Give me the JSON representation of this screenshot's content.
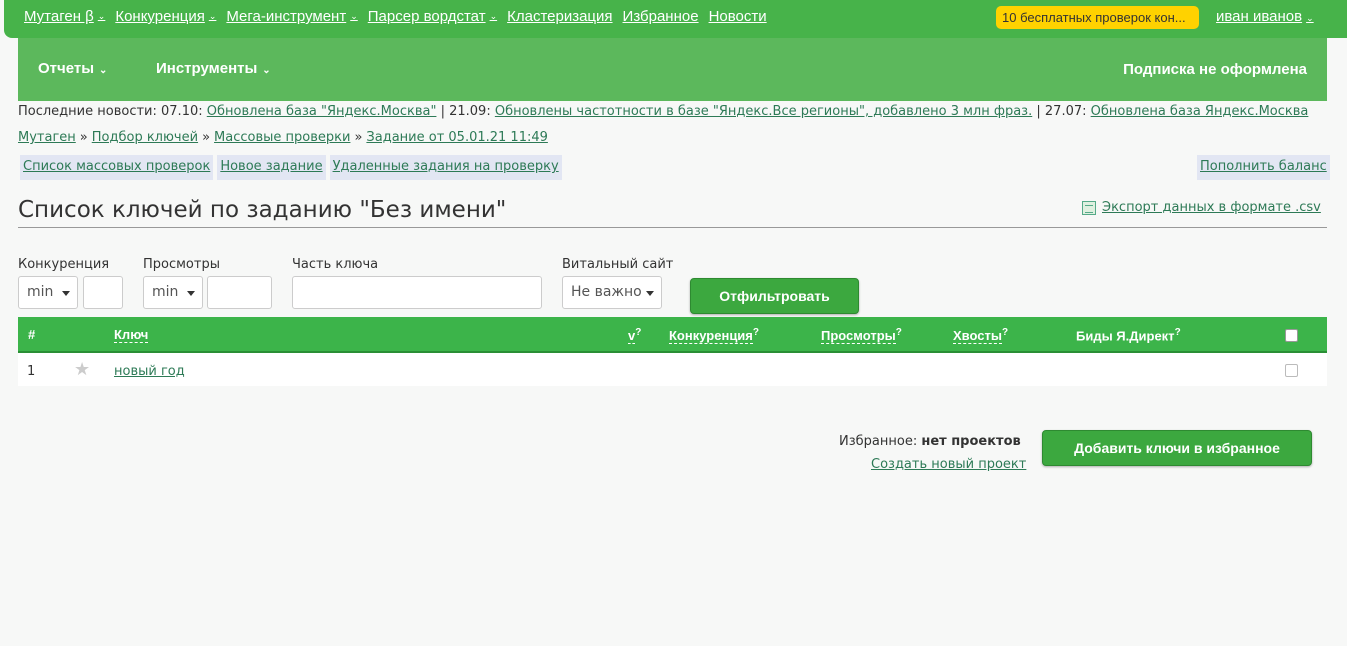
{
  "topnav": {
    "items": [
      {
        "label": "Мутаген β",
        "dropdown": true
      },
      {
        "label": "Конкуренция",
        "dropdown": true
      },
      {
        "label": "Мега-инструмент",
        "dropdown": true
      },
      {
        "label": "Парсер вордстат",
        "dropdown": true
      },
      {
        "label": "Кластеризация",
        "dropdown": false
      },
      {
        "label": "Избранное",
        "dropdown": false
      },
      {
        "label": "Новости",
        "dropdown": false
      }
    ],
    "promo": "10 бесплатных проверок кон...",
    "user": "иван иванов"
  },
  "subbar": {
    "reports": "Отчеты",
    "tools": "Инструменты",
    "subscription": "Подписка не оформлена"
  },
  "news": {
    "prefix": "Последние новости:",
    "items": [
      {
        "date": "07.10:",
        "text": "Обновлена база \"Яндекс.Москва\""
      },
      {
        "date": "21.09:",
        "text": "Обновлены частотности в базе \"Яндекс.Все регионы\", добавлено 3 млн фраз."
      },
      {
        "date": "27.07:",
        "text": "Обновлена база Яндекс.Москва"
      }
    ]
  },
  "breadcrumbs": [
    "Мутаген",
    "Подбор ключей",
    "Массовые проверки",
    "Задание от 05.01.21 11:49"
  ],
  "tabs": {
    "list": "Список массовых проверок",
    "new": "Новое задание",
    "deleted": "Удаленные задания на проверку",
    "balance": "Пополнить баланс"
  },
  "page": {
    "title": "Список ключей по заданию \"Без имени\"",
    "export": "Экспорт данных в формате .csv"
  },
  "filters": {
    "competition_label": "Конкуренция",
    "competition_select": "min",
    "views_label": "Просмотры",
    "views_select": "min",
    "part_label": "Часть ключа",
    "vital_label": "Витальный сайт",
    "vital_select": "Не важно",
    "submit": "Отфильтровать"
  },
  "table": {
    "headers": {
      "num": "#",
      "key": "Ключ",
      "v": "v",
      "competition": "Конкуренция",
      "views": "Просмотры",
      "tails": "Хвосты",
      "bids": "Биды Я.Директ",
      "q": "?"
    },
    "rows": [
      {
        "num": "1",
        "key": "новый год"
      }
    ]
  },
  "favorites": {
    "label": "Избранное:",
    "value": "нет проектов",
    "create": "Создать новый проект",
    "add_button": "Добавить ключи в избранное"
  }
}
